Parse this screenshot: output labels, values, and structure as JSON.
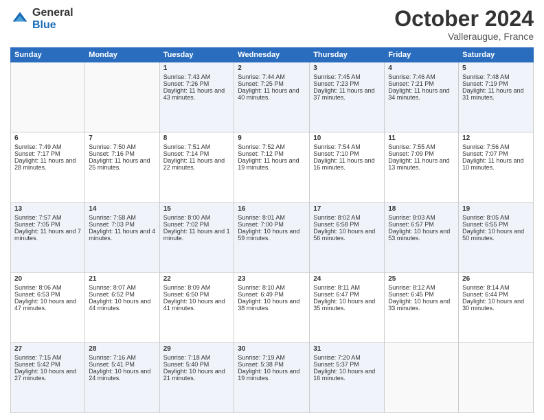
{
  "header": {
    "logo_general": "General",
    "logo_blue": "Blue",
    "month_title": "October 2024",
    "subtitle": "Valleraugue, France"
  },
  "days_of_week": [
    "Sunday",
    "Monday",
    "Tuesday",
    "Wednesday",
    "Thursday",
    "Friday",
    "Saturday"
  ],
  "weeks": [
    [
      {
        "day": "",
        "sunrise": "",
        "sunset": "",
        "daylight": "",
        "empty": true
      },
      {
        "day": "",
        "sunrise": "",
        "sunset": "",
        "daylight": "",
        "empty": true
      },
      {
        "day": "1",
        "sunrise": "Sunrise: 7:43 AM",
        "sunset": "Sunset: 7:26 PM",
        "daylight": "Daylight: 11 hours and 43 minutes.",
        "empty": false
      },
      {
        "day": "2",
        "sunrise": "Sunrise: 7:44 AM",
        "sunset": "Sunset: 7:25 PM",
        "daylight": "Daylight: 11 hours and 40 minutes.",
        "empty": false
      },
      {
        "day": "3",
        "sunrise": "Sunrise: 7:45 AM",
        "sunset": "Sunset: 7:23 PM",
        "daylight": "Daylight: 11 hours and 37 minutes.",
        "empty": false
      },
      {
        "day": "4",
        "sunrise": "Sunrise: 7:46 AM",
        "sunset": "Sunset: 7:21 PM",
        "daylight": "Daylight: 11 hours and 34 minutes.",
        "empty": false
      },
      {
        "day": "5",
        "sunrise": "Sunrise: 7:48 AM",
        "sunset": "Sunset: 7:19 PM",
        "daylight": "Daylight: 11 hours and 31 minutes.",
        "empty": false
      }
    ],
    [
      {
        "day": "6",
        "sunrise": "Sunrise: 7:49 AM",
        "sunset": "Sunset: 7:17 PM",
        "daylight": "Daylight: 11 hours and 28 minutes.",
        "empty": false
      },
      {
        "day": "7",
        "sunrise": "Sunrise: 7:50 AM",
        "sunset": "Sunset: 7:16 PM",
        "daylight": "Daylight: 11 hours and 25 minutes.",
        "empty": false
      },
      {
        "day": "8",
        "sunrise": "Sunrise: 7:51 AM",
        "sunset": "Sunset: 7:14 PM",
        "daylight": "Daylight: 11 hours and 22 minutes.",
        "empty": false
      },
      {
        "day": "9",
        "sunrise": "Sunrise: 7:52 AM",
        "sunset": "Sunset: 7:12 PM",
        "daylight": "Daylight: 11 hours and 19 minutes.",
        "empty": false
      },
      {
        "day": "10",
        "sunrise": "Sunrise: 7:54 AM",
        "sunset": "Sunset: 7:10 PM",
        "daylight": "Daylight: 11 hours and 16 minutes.",
        "empty": false
      },
      {
        "day": "11",
        "sunrise": "Sunrise: 7:55 AM",
        "sunset": "Sunset: 7:09 PM",
        "daylight": "Daylight: 11 hours and 13 minutes.",
        "empty": false
      },
      {
        "day": "12",
        "sunrise": "Sunrise: 7:56 AM",
        "sunset": "Sunset: 7:07 PM",
        "daylight": "Daylight: 11 hours and 10 minutes.",
        "empty": false
      }
    ],
    [
      {
        "day": "13",
        "sunrise": "Sunrise: 7:57 AM",
        "sunset": "Sunset: 7:05 PM",
        "daylight": "Daylight: 11 hours and 7 minutes.",
        "empty": false
      },
      {
        "day": "14",
        "sunrise": "Sunrise: 7:58 AM",
        "sunset": "Sunset: 7:03 PM",
        "daylight": "Daylight: 11 hours and 4 minutes.",
        "empty": false
      },
      {
        "day": "15",
        "sunrise": "Sunrise: 8:00 AM",
        "sunset": "Sunset: 7:02 PM",
        "daylight": "Daylight: 11 hours and 1 minute.",
        "empty": false
      },
      {
        "day": "16",
        "sunrise": "Sunrise: 8:01 AM",
        "sunset": "Sunset: 7:00 PM",
        "daylight": "Daylight: 10 hours and 59 minutes.",
        "empty": false
      },
      {
        "day": "17",
        "sunrise": "Sunrise: 8:02 AM",
        "sunset": "Sunset: 6:58 PM",
        "daylight": "Daylight: 10 hours and 56 minutes.",
        "empty": false
      },
      {
        "day": "18",
        "sunrise": "Sunrise: 8:03 AM",
        "sunset": "Sunset: 6:57 PM",
        "daylight": "Daylight: 10 hours and 53 minutes.",
        "empty": false
      },
      {
        "day": "19",
        "sunrise": "Sunrise: 8:05 AM",
        "sunset": "Sunset: 6:55 PM",
        "daylight": "Daylight: 10 hours and 50 minutes.",
        "empty": false
      }
    ],
    [
      {
        "day": "20",
        "sunrise": "Sunrise: 8:06 AM",
        "sunset": "Sunset: 6:53 PM",
        "daylight": "Daylight: 10 hours and 47 minutes.",
        "empty": false
      },
      {
        "day": "21",
        "sunrise": "Sunrise: 8:07 AM",
        "sunset": "Sunset: 6:52 PM",
        "daylight": "Daylight: 10 hours and 44 minutes.",
        "empty": false
      },
      {
        "day": "22",
        "sunrise": "Sunrise: 8:09 AM",
        "sunset": "Sunset: 6:50 PM",
        "daylight": "Daylight: 10 hours and 41 minutes.",
        "empty": false
      },
      {
        "day": "23",
        "sunrise": "Sunrise: 8:10 AM",
        "sunset": "Sunset: 6:49 PM",
        "daylight": "Daylight: 10 hours and 38 minutes.",
        "empty": false
      },
      {
        "day": "24",
        "sunrise": "Sunrise: 8:11 AM",
        "sunset": "Sunset: 6:47 PM",
        "daylight": "Daylight: 10 hours and 35 minutes.",
        "empty": false
      },
      {
        "day": "25",
        "sunrise": "Sunrise: 8:12 AM",
        "sunset": "Sunset: 6:45 PM",
        "daylight": "Daylight: 10 hours and 33 minutes.",
        "empty": false
      },
      {
        "day": "26",
        "sunrise": "Sunrise: 8:14 AM",
        "sunset": "Sunset: 6:44 PM",
        "daylight": "Daylight: 10 hours and 30 minutes.",
        "empty": false
      }
    ],
    [
      {
        "day": "27",
        "sunrise": "Sunrise: 7:15 AM",
        "sunset": "Sunset: 5:42 PM",
        "daylight": "Daylight: 10 hours and 27 minutes.",
        "empty": false
      },
      {
        "day": "28",
        "sunrise": "Sunrise: 7:16 AM",
        "sunset": "Sunset: 5:41 PM",
        "daylight": "Daylight: 10 hours and 24 minutes.",
        "empty": false
      },
      {
        "day": "29",
        "sunrise": "Sunrise: 7:18 AM",
        "sunset": "Sunset: 5:40 PM",
        "daylight": "Daylight: 10 hours and 21 minutes.",
        "empty": false
      },
      {
        "day": "30",
        "sunrise": "Sunrise: 7:19 AM",
        "sunset": "Sunset: 5:38 PM",
        "daylight": "Daylight: 10 hours and 19 minutes.",
        "empty": false
      },
      {
        "day": "31",
        "sunrise": "Sunrise: 7:20 AM",
        "sunset": "Sunset: 5:37 PM",
        "daylight": "Daylight: 10 hours and 16 minutes.",
        "empty": false
      },
      {
        "day": "",
        "sunrise": "",
        "sunset": "",
        "daylight": "",
        "empty": true
      },
      {
        "day": "",
        "sunrise": "",
        "sunset": "",
        "daylight": "",
        "empty": true
      }
    ]
  ]
}
